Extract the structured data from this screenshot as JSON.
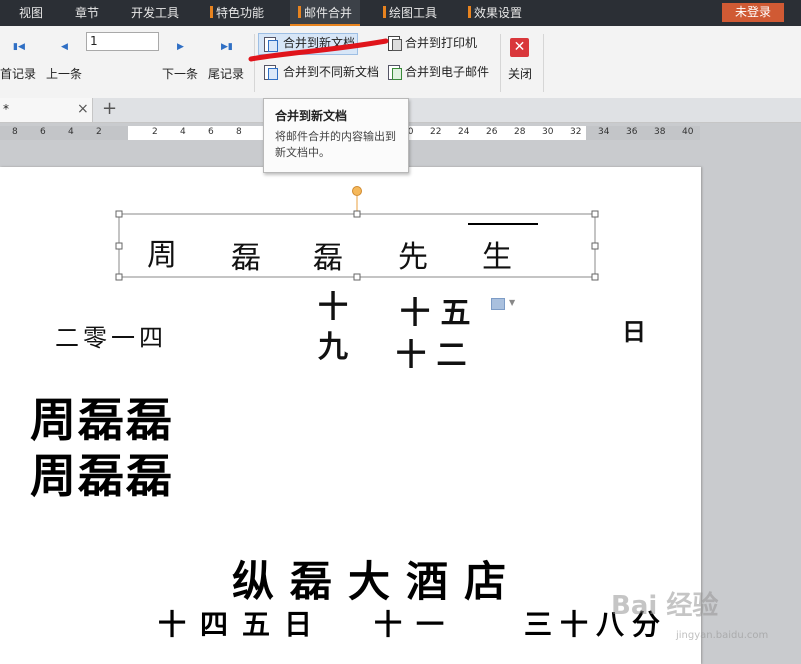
{
  "menu": {
    "tabs": [
      {
        "label": "视图"
      },
      {
        "label": "章节"
      },
      {
        "label": "开发工具"
      },
      {
        "label": "特色功能"
      },
      {
        "label": "邮件合并"
      },
      {
        "label": "绘图工具"
      },
      {
        "label": "效果设置"
      }
    ],
    "login": "未登录"
  },
  "toolbar": {
    "record_value": "1",
    "first_record": "首记录",
    "prev_record": "上一条",
    "next_record": "下一条",
    "last_record": "尾记录",
    "merge_new_doc": "合并到新文档",
    "merge_diff_docs": "合并到不同新文档",
    "merge_printer": "合并到打印机",
    "merge_email": "合并到电子邮件",
    "close": "关闭"
  },
  "tooltip": {
    "title": "合并到新文档",
    "body": "将邮件合并的内容输出到新文档中。"
  },
  "tabstrip": {
    "doc_tab": "*",
    "close_symbol": "×",
    "add_symbol": "+"
  },
  "ruler": {
    "left_ticks": [
      "8",
      "6",
      "4",
      "2"
    ],
    "right_ticks": [
      "2",
      "4",
      "6",
      "8"
    ],
    "far_ticks": [
      "20",
      "22",
      "24",
      "26",
      "28",
      "30",
      "32",
      "34",
      "36",
      "38",
      "40"
    ]
  },
  "document": {
    "header_chars": [
      "周",
      "磊",
      "磊",
      "先",
      "生"
    ],
    "line_year": [
      "二",
      "零",
      "一",
      "四"
    ],
    "col_month": [
      "九",
      "十"
    ],
    "col_day": [
      "十",
      "二"
    ],
    "top_right_chars": [
      "十",
      "五"
    ],
    "right_char": "日",
    "name_rows": [
      [
        "周",
        "磊",
        "磊"
      ],
      [
        "周",
        "磊",
        "磊"
      ]
    ],
    "venue": [
      "纵",
      "磊",
      "大",
      "酒",
      "店"
    ],
    "bottom_left": [
      "十",
      "四",
      "五",
      "日"
    ],
    "bottom_mid": [
      "十",
      "一"
    ],
    "bottom_right": [
      "三",
      "十",
      "八",
      "分"
    ]
  },
  "watermark": {
    "text": "Bai 经验",
    "sub": "jingyan.baidu.com"
  }
}
